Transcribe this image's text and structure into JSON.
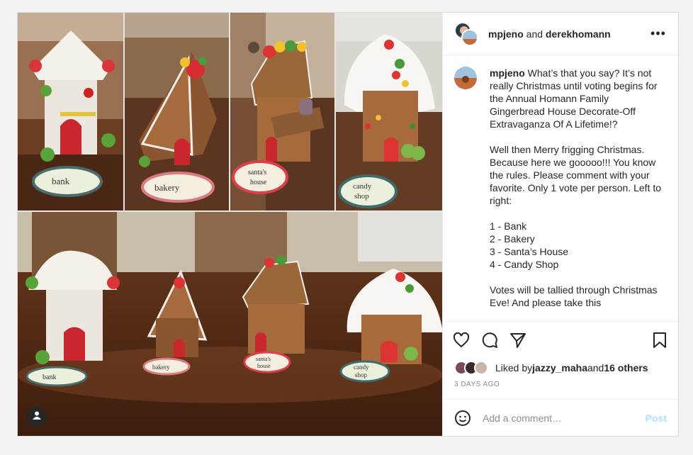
{
  "header": {
    "user1": "mpjeno",
    "and_text": "and",
    "user2": "derekhomann",
    "more_icon": "more-horizontal-icon"
  },
  "caption": {
    "username": "mpjeno",
    "text": " What’s that you say? It’s not really Christmas until voting begins for the Annual Homann Family Gingerbread House Decorate-Off Extravaganza Of A Lifetime!?\n\nWell then Merry frigging Christmas. Because here we gooooo!!! You know the rules. Please comment with your favorite. Only 1 vote per person. Left to right:\n\n1 - Bank\n2 - Bakery\n3 - Santa’s House\n4 - Candy Shop\n\nVotes will be tallied through Christmas Eve! And please take this"
  },
  "photo_labels": {
    "bank": "bank",
    "bakery": "bakery",
    "santas_house_line1": "santa's",
    "santas_house_line2": "house",
    "candy_shop_line1": "candy",
    "candy_shop_line2": "shop"
  },
  "actions": {
    "like_icon": "heart-icon",
    "comment_icon": "comment-icon",
    "share_icon": "share-icon",
    "save_icon": "bookmark-icon"
  },
  "likes": {
    "prefix": "Liked by ",
    "user": "jazzy_maha",
    "middle": " and ",
    "others": "16 others"
  },
  "timestamp": "3 DAYS AGO",
  "comment": {
    "placeholder": "Add a comment…",
    "post_label": "Post"
  },
  "colors": {
    "post_disabled": "#b2dffc",
    "border": "#dbdbdb",
    "meta_gray": "#8e8e8e"
  }
}
